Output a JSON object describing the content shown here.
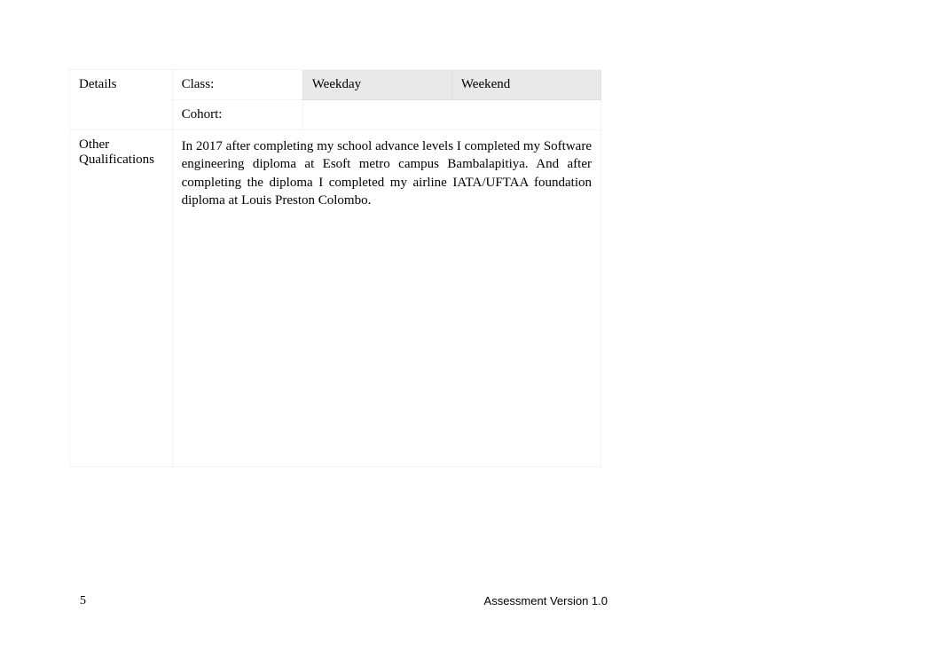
{
  "details": {
    "row_label": "Details",
    "class_label": "Class:",
    "cohort_label": "Cohort:",
    "option_weekday": "Weekday",
    "option_weekend": "Weekend"
  },
  "qualifications": {
    "row_label": "Other Qualifications",
    "text": "In 2017 after completing my school advance levels I completed my Software engineering diploma at Esoft metro campus Bambalapitiya. And after completing the diploma I completed my airline IATA/UFTAA foundation diploma at Louis Preston Colombo."
  },
  "footer": {
    "page_number": "5",
    "version_text": "Assessment Version 1.0"
  }
}
